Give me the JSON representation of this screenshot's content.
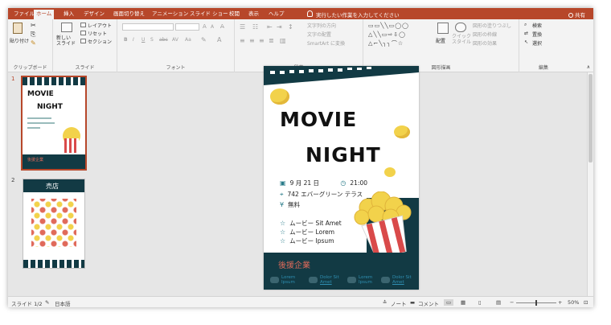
{
  "tabs": [
    "ファイル",
    "ホーム",
    "挿入",
    "デザイン",
    "画面切り替え",
    "アニメーション",
    "スライド ショー",
    "校閲",
    "表示",
    "ヘルプ"
  ],
  "tell_me": "実行したい作業を入力してください",
  "share": "共有",
  "ribbon": {
    "clipboard": {
      "label": "クリップボード",
      "paste": "貼り付け"
    },
    "slides": {
      "label": "スライド",
      "new_slide": "新しい\nスライド",
      "layout": "レイアウト",
      "reset": "リセット",
      "section": "セクション"
    },
    "font": {
      "label": "フォント",
      "bold": "B",
      "italic": "I",
      "underline": "U",
      "strike": "S",
      "abc": "abc",
      "av": "AV",
      "aa": "Aa",
      "grow": "A",
      "shrink": "A"
    },
    "paragraph": {
      "label": "段落",
      "text_direction": "文字列の方向",
      "align_text": "文字の配置",
      "smartart": "SmartArt に変換"
    },
    "drawing": {
      "label": "図形描画",
      "arrange": "配置",
      "quick_style": "クイック\nスタイル",
      "fill": "図形の塗りつぶし",
      "outline": "図形の枠線",
      "effects": "図形の効果"
    },
    "editing": {
      "label": "編集",
      "find": "検索",
      "replace": "置換",
      "select": "選択"
    }
  },
  "thumbnails": [
    {
      "number": "1",
      "title1": "MOVIE",
      "title2": "NIGHT",
      "sponsor": "後援企業"
    },
    {
      "number": "2",
      "title": "売店"
    }
  ],
  "slide": {
    "title1": "MOVIE",
    "title2": "NIGHT",
    "date": "9 月 21 日",
    "time": "21:00",
    "address": "742 エバーグリーン テラス",
    "price": "無料",
    "price_symbol": "¥",
    "movies": [
      "ムービー Sit Amet",
      "ムービー Lorem",
      "ムービー Ipsum"
    ],
    "sponsor_heading": "後援企業",
    "sponsors": [
      {
        "line1": "Lorem",
        "line2": "Ipsum"
      },
      {
        "line1": "Dolor Sit",
        "line2": "Amet"
      },
      {
        "line1": "Lorem",
        "line2": "Ipsum"
      },
      {
        "line1": "Dolor Sit",
        "line2": "Amet"
      }
    ]
  },
  "status": {
    "slide_counter": "スライド 1/2",
    "language": "日本語",
    "notes": "ノート",
    "comments": "コメント",
    "zoom": "50%"
  },
  "colors": {
    "ribbon_accent": "#b7472a",
    "slide_dark_teal": "#123a44",
    "sponsor_coral": "#e06a5a",
    "popcorn_yellow": "#f2d24b",
    "icon_teal": "#2a7c8a"
  }
}
